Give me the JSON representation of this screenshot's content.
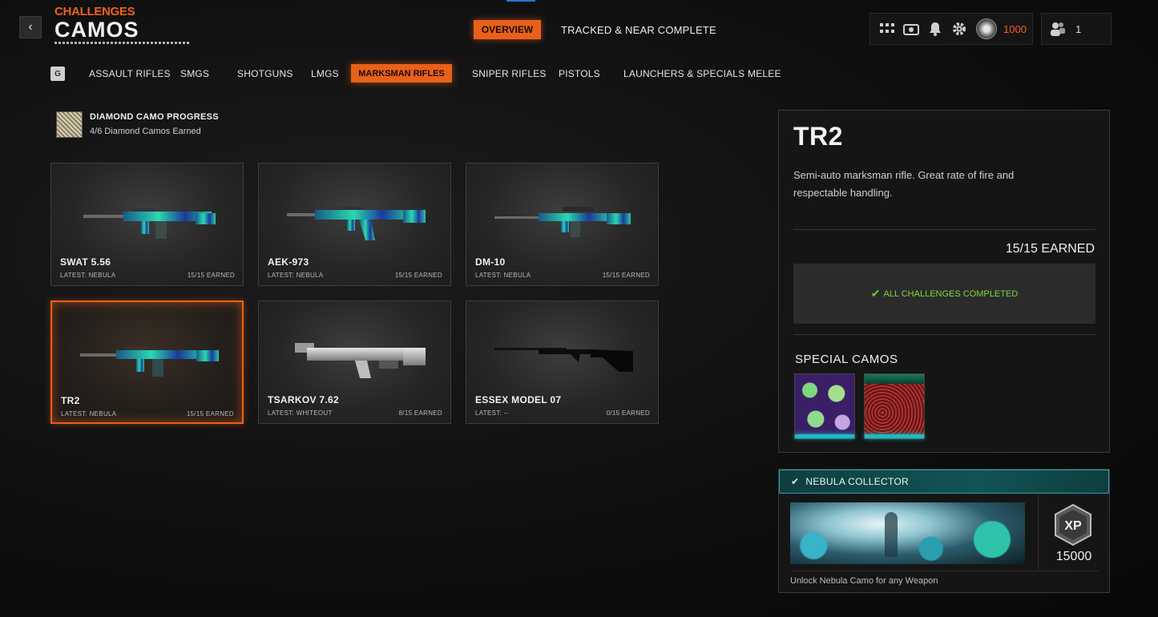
{
  "header": {
    "back_icon": "‹",
    "subtitle": "CHALLENGES",
    "title": "CAMOS"
  },
  "nav": {
    "overview": "OVERVIEW",
    "tracked": "TRACKED & NEAR COMPLETE"
  },
  "status": {
    "credits": "1000",
    "party_count": "1"
  },
  "categories": {
    "key_hint": "G",
    "items": [
      "ASSAULT RIFLES",
      "SMGS",
      "SHOTGUNS",
      "LMGS",
      "MARKSMAN RIFLES",
      "SNIPER RIFLES",
      "PISTOLS",
      "LAUNCHERS & SPECIALS",
      "MELEE"
    ],
    "active": "MARKSMAN RIFLES"
  },
  "diamond": {
    "title": "DIAMOND CAMO PROGRESS",
    "subtitle": "4/6 Diamond Camos Earned"
  },
  "weapons": [
    {
      "name": "SWAT 5.56",
      "latest": "LATEST: NEBULA",
      "earned": "15/15 EARNED",
      "camo": "nebula"
    },
    {
      "name": "AEK-973",
      "latest": "LATEST: NEBULA",
      "earned": "15/15 EARNED",
      "camo": "nebula"
    },
    {
      "name": "DM-10",
      "latest": "LATEST: NEBULA",
      "earned": "15/15 EARNED",
      "camo": "nebula"
    },
    {
      "name": "TR2",
      "latest": "LATEST: NEBULA",
      "earned": "15/15 EARNED",
      "camo": "nebula"
    },
    {
      "name": "TSARKOV 7.62",
      "latest": "LATEST: WHITEOUT",
      "earned": "8/15 EARNED",
      "camo": "whiteout"
    },
    {
      "name": "ESSEX MODEL 07",
      "latest": "LATEST: --",
      "earned": "0/15 EARNED",
      "camo": "none"
    }
  ],
  "detail": {
    "name": "TR2",
    "description": "Semi-auto marksman rifle.  Great rate of fire and respectable handling.",
    "earned": "15/15 EARNED",
    "complete_text": "ALL CHALLENGES COMPLETED",
    "special_title": "SPECIAL CAMOS"
  },
  "reward": {
    "title": "NEBULA COLLECTOR",
    "xp": "15000",
    "description": "Unlock Nebula Camo for any Weapon"
  },
  "colors": {
    "accent": "#e9601a",
    "complete_green": "#6cd02a",
    "teal": "#1fb8c4"
  }
}
